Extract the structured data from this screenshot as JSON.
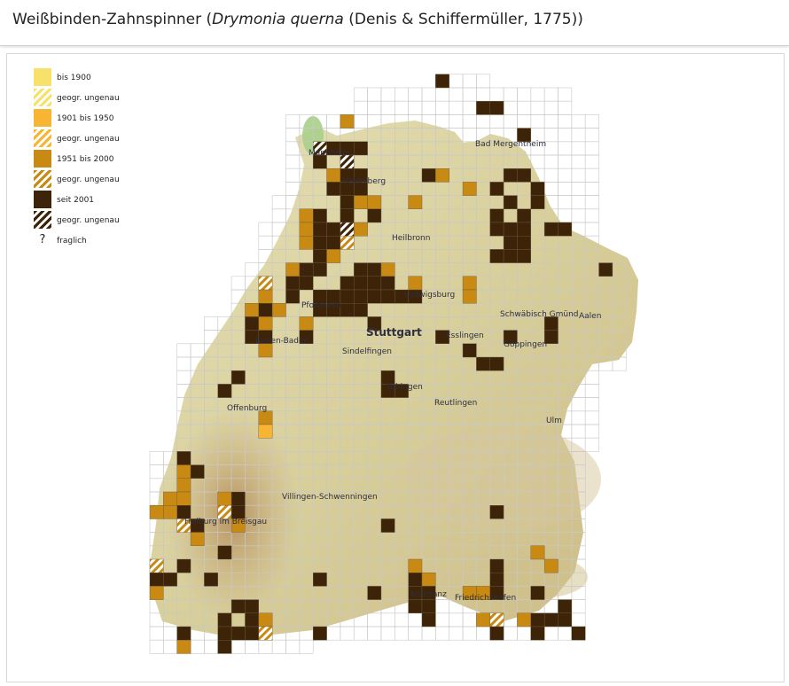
{
  "header": {
    "title_pre": "Weißbinden-Zahnspinner (",
    "title_sci": "Drymonia querna",
    "title_post": " (Denis & Schiffermüller, 1775))"
  },
  "legend": [
    {
      "label": "bis 1900",
      "color": "#f7e16b",
      "hatched": false
    },
    {
      "label": "geogr. ungenau",
      "color": "#f7e16b",
      "hatched": true
    },
    {
      "label": "1901 bis 1950",
      "color": "#f8b534",
      "hatched": false
    },
    {
      "label": "geogr. ungenau",
      "color": "#f8b534",
      "hatched": true
    },
    {
      "label": "1951 bis 2000",
      "color": "#c98a13",
      "hatched": false
    },
    {
      "label": "geogr. ungenau",
      "color": "#c98a13",
      "hatched": true
    },
    {
      "label": "seit 2001",
      "color": "#3d2408",
      "hatched": false
    },
    {
      "label": "geogr. ungenau",
      "color": "#3d2408",
      "hatched": true
    },
    {
      "label": "fraglich",
      "symbol": "?"
    }
  ],
  "map": {
    "colors": {
      "period_1951_2000": "#c98a13",
      "period_1901_1950": "#f8b534",
      "since_2001": "#3d2408",
      "relief_light": "#e3ddb0",
      "relief_dark": "#c7a774",
      "water": "#a9cf8a",
      "grid_line": "#c8c8c8"
    },
    "cities": [
      "Mannheim",
      "Heidelberg",
      "Bad Mergentheim",
      "Heilbronn",
      "Ludwigsburg",
      "Pforzheim",
      "Stuttgart",
      "Esslingen",
      "Sindelfingen",
      "Schwäbisch Gmünd",
      "Aalen",
      "Göppingen",
      "Baden-Baden",
      "Offenburg",
      "Tübingen",
      "Reutlingen",
      "Ulm",
      "Freiburg im Breisgau",
      "Villingen-Schwenningen",
      "Konstanz",
      "Friedrichshafen"
    ],
    "cells": [
      {
        "c": 21,
        "r": -1,
        "p": "since_2001"
      },
      {
        "c": 24,
        "r": 1,
        "p": "since_2001"
      },
      {
        "c": 25,
        "r": 1,
        "p": "since_2001"
      },
      {
        "c": 14,
        "r": 2,
        "p": "period_1951_2000"
      },
      {
        "c": 27,
        "r": 3,
        "p": "since_2001"
      },
      {
        "c": 12,
        "r": 4,
        "p": "since_2001",
        "h": true
      },
      {
        "c": 13,
        "r": 4,
        "p": "since_2001"
      },
      {
        "c": 14,
        "r": 4,
        "p": "since_2001"
      },
      {
        "c": 15,
        "r": 4,
        "p": "since_2001"
      },
      {
        "c": 12,
        "r": 5,
        "p": "since_2001"
      },
      {
        "c": 14,
        "r": 5,
        "p": "since_2001",
        "h": true
      },
      {
        "c": 13,
        "r": 6,
        "p": "period_1951_2000"
      },
      {
        "c": 14,
        "r": 6,
        "p": "since_2001"
      },
      {
        "c": 15,
        "r": 6,
        "p": "since_2001"
      },
      {
        "c": 20,
        "r": 6,
        "p": "since_2001"
      },
      {
        "c": 21,
        "r": 6,
        "p": "period_1951_2000"
      },
      {
        "c": 26,
        "r": 6,
        "p": "since_2001"
      },
      {
        "c": 27,
        "r": 6,
        "p": "since_2001"
      },
      {
        "c": 13,
        "r": 7,
        "p": "since_2001"
      },
      {
        "c": 14,
        "r": 7,
        "p": "since_2001"
      },
      {
        "c": 15,
        "r": 7,
        "p": "since_2001"
      },
      {
        "c": 23,
        "r": 7,
        "p": "period_1951_2000"
      },
      {
        "c": 25,
        "r": 7,
        "p": "since_2001"
      },
      {
        "c": 28,
        "r": 7,
        "p": "since_2001"
      },
      {
        "c": 14,
        "r": 8,
        "p": "since_2001"
      },
      {
        "c": 15,
        "r": 8,
        "p": "period_1951_2000"
      },
      {
        "c": 16,
        "r": 8,
        "p": "period_1951_2000"
      },
      {
        "c": 19,
        "r": 8,
        "p": "period_1951_2000"
      },
      {
        "c": 26,
        "r": 8,
        "p": "since_2001"
      },
      {
        "c": 28,
        "r": 8,
        "p": "since_2001"
      },
      {
        "c": 11,
        "r": 9,
        "p": "period_1951_2000"
      },
      {
        "c": 12,
        "r": 9,
        "p": "since_2001"
      },
      {
        "c": 14,
        "r": 9,
        "p": "since_2001"
      },
      {
        "c": 16,
        "r": 9,
        "p": "since_2001"
      },
      {
        "c": 25,
        "r": 9,
        "p": "since_2001"
      },
      {
        "c": 27,
        "r": 9,
        "p": "since_2001"
      },
      {
        "c": 11,
        "r": 10,
        "p": "period_1951_2000"
      },
      {
        "c": 12,
        "r": 10,
        "p": "since_2001"
      },
      {
        "c": 13,
        "r": 10,
        "p": "since_2001"
      },
      {
        "c": 14,
        "r": 10,
        "p": "since_2001",
        "h": true
      },
      {
        "c": 15,
        "r": 10,
        "p": "period_1951_2000"
      },
      {
        "c": 25,
        "r": 10,
        "p": "since_2001"
      },
      {
        "c": 26,
        "r": 10,
        "p": "since_2001"
      },
      {
        "c": 27,
        "r": 10,
        "p": "since_2001"
      },
      {
        "c": 29,
        "r": 10,
        "p": "since_2001"
      },
      {
        "c": 30,
        "r": 10,
        "p": "since_2001"
      },
      {
        "c": 11,
        "r": 11,
        "p": "period_1951_2000"
      },
      {
        "c": 12,
        "r": 11,
        "p": "since_2001"
      },
      {
        "c": 13,
        "r": 11,
        "p": "since_2001"
      },
      {
        "c": 14,
        "r": 11,
        "p": "period_1951_2000",
        "h": true
      },
      {
        "c": 26,
        "r": 11,
        "p": "since_2001"
      },
      {
        "c": 27,
        "r": 11,
        "p": "since_2001"
      },
      {
        "c": 12,
        "r": 12,
        "p": "since_2001"
      },
      {
        "c": 13,
        "r": 12,
        "p": "period_1951_2000"
      },
      {
        "c": 25,
        "r": 12,
        "p": "since_2001"
      },
      {
        "c": 26,
        "r": 12,
        "p": "since_2001"
      },
      {
        "c": 27,
        "r": 12,
        "p": "since_2001"
      },
      {
        "c": 10,
        "r": 13,
        "p": "period_1951_2000"
      },
      {
        "c": 11,
        "r": 13,
        "p": "since_2001"
      },
      {
        "c": 12,
        "r": 13,
        "p": "since_2001"
      },
      {
        "c": 15,
        "r": 13,
        "p": "since_2001"
      },
      {
        "c": 16,
        "r": 13,
        "p": "since_2001"
      },
      {
        "c": 17,
        "r": 13,
        "p": "period_1951_2000"
      },
      {
        "c": 33,
        "r": 13,
        "p": "since_2001"
      },
      {
        "c": 8,
        "r": 14,
        "p": "period_1951_2000",
        "h": true
      },
      {
        "c": 10,
        "r": 14,
        "p": "since_2001"
      },
      {
        "c": 11,
        "r": 14,
        "p": "since_2001"
      },
      {
        "c": 14,
        "r": 14,
        "p": "since_2001"
      },
      {
        "c": 15,
        "r": 14,
        "p": "since_2001"
      },
      {
        "c": 16,
        "r": 14,
        "p": "since_2001"
      },
      {
        "c": 17,
        "r": 14,
        "p": "since_2001"
      },
      {
        "c": 19,
        "r": 14,
        "p": "period_1951_2000"
      },
      {
        "c": 23,
        "r": 14,
        "p": "period_1951_2000"
      },
      {
        "c": 8,
        "r": 15,
        "p": "period_1951_2000"
      },
      {
        "c": 10,
        "r": 15,
        "p": "since_2001"
      },
      {
        "c": 12,
        "r": 15,
        "p": "since_2001"
      },
      {
        "c": 13,
        "r": 15,
        "p": "since_2001"
      },
      {
        "c": 14,
        "r": 15,
        "p": "since_2001"
      },
      {
        "c": 15,
        "r": 15,
        "p": "since_2001"
      },
      {
        "c": 16,
        "r": 15,
        "p": "since_2001"
      },
      {
        "c": 17,
        "r": 15,
        "p": "since_2001"
      },
      {
        "c": 18,
        "r": 15,
        "p": "since_2001"
      },
      {
        "c": 19,
        "r": 15,
        "p": "since_2001"
      },
      {
        "c": 23,
        "r": 15,
        "p": "period_1951_2000"
      },
      {
        "c": 7,
        "r": 16,
        "p": "period_1951_2000"
      },
      {
        "c": 8,
        "r": 16,
        "p": "since_2001"
      },
      {
        "c": 9,
        "r": 16,
        "p": "period_1951_2000"
      },
      {
        "c": 12,
        "r": 16,
        "p": "since_2001"
      },
      {
        "c": 13,
        "r": 16,
        "p": "since_2001"
      },
      {
        "c": 14,
        "r": 16,
        "p": "since_2001"
      },
      {
        "c": 15,
        "r": 16,
        "p": "since_2001"
      },
      {
        "c": 7,
        "r": 17,
        "p": "since_2001"
      },
      {
        "c": 8,
        "r": 17,
        "p": "period_1951_2000"
      },
      {
        "c": 11,
        "r": 17,
        "p": "period_1951_2000"
      },
      {
        "c": 16,
        "r": 17,
        "p": "since_2001"
      },
      {
        "c": 29,
        "r": 17,
        "p": "since_2001"
      },
      {
        "c": 7,
        "r": 18,
        "p": "since_2001"
      },
      {
        "c": 8,
        "r": 18,
        "p": "since_2001"
      },
      {
        "c": 11,
        "r": 18,
        "p": "since_2001"
      },
      {
        "c": 21,
        "r": 18,
        "p": "since_2001"
      },
      {
        "c": 26,
        "r": 18,
        "p": "since_2001"
      },
      {
        "c": 29,
        "r": 18,
        "p": "since_2001"
      },
      {
        "c": 8,
        "r": 19,
        "p": "period_1951_2000"
      },
      {
        "c": 23,
        "r": 19,
        "p": "since_2001"
      },
      {
        "c": 24,
        "r": 20,
        "p": "since_2001"
      },
      {
        "c": 25,
        "r": 20,
        "p": "since_2001"
      },
      {
        "c": 6,
        "r": 21,
        "p": "since_2001"
      },
      {
        "c": 17,
        "r": 21,
        "p": "since_2001"
      },
      {
        "c": 5,
        "r": 22,
        "p": "since_2001"
      },
      {
        "c": 17,
        "r": 22,
        "p": "since_2001"
      },
      {
        "c": 18,
        "r": 22,
        "p": "since_2001"
      },
      {
        "c": 8,
        "r": 24,
        "p": "period_1951_2000"
      },
      {
        "c": 8,
        "r": 25,
        "p": "period_1901_1950"
      },
      {
        "c": 2,
        "r": 27,
        "p": "since_2001"
      },
      {
        "c": 2,
        "r": 28,
        "p": "period_1951_2000"
      },
      {
        "c": 3,
        "r": 28,
        "p": "since_2001"
      },
      {
        "c": 2,
        "r": 29,
        "p": "period_1951_2000"
      },
      {
        "c": 1,
        "r": 30,
        "p": "period_1951_2000"
      },
      {
        "c": 2,
        "r": 30,
        "p": "period_1951_2000"
      },
      {
        "c": 5,
        "r": 30,
        "p": "period_1951_2000"
      },
      {
        "c": 6,
        "r": 30,
        "p": "since_2001"
      },
      {
        "c": 0,
        "r": 31,
        "p": "period_1951_2000"
      },
      {
        "c": 1,
        "r": 31,
        "p": "period_1951_2000"
      },
      {
        "c": 2,
        "r": 31,
        "p": "since_2001"
      },
      {
        "c": 5,
        "r": 31,
        "p": "period_1951_2000",
        "h": true
      },
      {
        "c": 6,
        "r": 31,
        "p": "since_2001"
      },
      {
        "c": 25,
        "r": 31,
        "p": "since_2001"
      },
      {
        "c": 2,
        "r": 32,
        "p": "period_1951_2000",
        "h": true
      },
      {
        "c": 3,
        "r": 32,
        "p": "since_2001"
      },
      {
        "c": 6,
        "r": 32,
        "p": "period_1951_2000"
      },
      {
        "c": 17,
        "r": 32,
        "p": "since_2001"
      },
      {
        "c": 3,
        "r": 33,
        "p": "period_1951_2000"
      },
      {
        "c": 5,
        "r": 34,
        "p": "since_2001"
      },
      {
        "c": 28,
        "r": 34,
        "p": "period_1951_2000"
      },
      {
        "c": 0,
        "r": 35,
        "p": "period_1951_2000",
        "h": true
      },
      {
        "c": 2,
        "r": 35,
        "p": "since_2001"
      },
      {
        "c": 19,
        "r": 35,
        "p": "period_1951_2000"
      },
      {
        "c": 25,
        "r": 35,
        "p": "since_2001"
      },
      {
        "c": 29,
        "r": 35,
        "p": "period_1951_2000"
      },
      {
        "c": 0,
        "r": 36,
        "p": "since_2001"
      },
      {
        "c": 1,
        "r": 36,
        "p": "since_2001"
      },
      {
        "c": 4,
        "r": 36,
        "p": "since_2001"
      },
      {
        "c": 12,
        "r": 36,
        "p": "since_2001"
      },
      {
        "c": 19,
        "r": 36,
        "p": "since_2001"
      },
      {
        "c": 20,
        "r": 36,
        "p": "period_1951_2000"
      },
      {
        "c": 25,
        "r": 36,
        "p": "since_2001"
      },
      {
        "c": 0,
        "r": 37,
        "p": "period_1951_2000"
      },
      {
        "c": 16,
        "r": 37,
        "p": "since_2001"
      },
      {
        "c": 19,
        "r": 37,
        "p": "since_2001"
      },
      {
        "c": 20,
        "r": 37,
        "p": "since_2001"
      },
      {
        "c": 23,
        "r": 37,
        "p": "period_1951_2000"
      },
      {
        "c": 24,
        "r": 37,
        "p": "period_1951_2000"
      },
      {
        "c": 25,
        "r": 37,
        "p": "since_2001"
      },
      {
        "c": 28,
        "r": 37,
        "p": "since_2001"
      },
      {
        "c": 6,
        "r": 38,
        "p": "since_2001"
      },
      {
        "c": 7,
        "r": 38,
        "p": "since_2001"
      },
      {
        "c": 19,
        "r": 38,
        "p": "since_2001"
      },
      {
        "c": 20,
        "r": 38,
        "p": "since_2001"
      },
      {
        "c": 30,
        "r": 38,
        "p": "since_2001"
      },
      {
        "c": 5,
        "r": 39,
        "p": "since_2001"
      },
      {
        "c": 7,
        "r": 39,
        "p": "since_2001"
      },
      {
        "c": 8,
        "r": 39,
        "p": "period_1951_2000"
      },
      {
        "c": 20,
        "r": 39,
        "p": "since_2001"
      },
      {
        "c": 24,
        "r": 39,
        "p": "period_1951_2000"
      },
      {
        "c": 25,
        "r": 39,
        "p": "period_1951_2000",
        "h": true
      },
      {
        "c": 27,
        "r": 39,
        "p": "period_1951_2000"
      },
      {
        "c": 28,
        "r": 39,
        "p": "since_2001"
      },
      {
        "c": 29,
        "r": 39,
        "p": "since_2001"
      },
      {
        "c": 30,
        "r": 39,
        "p": "since_2001"
      },
      {
        "c": 2,
        "r": 40,
        "p": "since_2001"
      },
      {
        "c": 5,
        "r": 40,
        "p": "since_2001"
      },
      {
        "c": 6,
        "r": 40,
        "p": "since_2001"
      },
      {
        "c": 7,
        "r": 40,
        "p": "since_2001"
      },
      {
        "c": 8,
        "r": 40,
        "p": "period_1951_2000",
        "h": true
      },
      {
        "c": 12,
        "r": 40,
        "p": "since_2001"
      },
      {
        "c": 25,
        "r": 40,
        "p": "since_2001"
      },
      {
        "c": 28,
        "r": 40,
        "p": "since_2001"
      },
      {
        "c": 31,
        "r": 40,
        "p": "since_2001"
      },
      {
        "c": 2,
        "r": 41,
        "p": "period_1951_2000"
      },
      {
        "c": 5,
        "r": 41,
        "p": "since_2001"
      }
    ]
  }
}
